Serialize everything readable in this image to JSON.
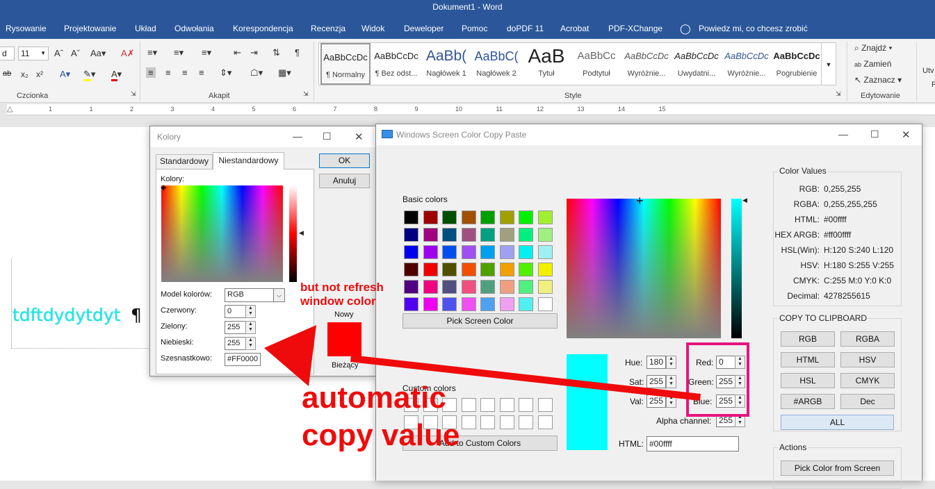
{
  "word": {
    "title": "Dokument1  -  Word",
    "tabs": [
      "Rysowanie",
      "Projektowanie",
      "Układ",
      "Odwołania",
      "Korespondencja",
      "Recenzja",
      "Widok",
      "Deweloper",
      "Pomoc",
      "doPDF 11",
      "Acrobat",
      "PDF-XChange"
    ],
    "tell_me": "Powiedz mi, co chcesz zrobić",
    "font_name_fragment": "d",
    "font_size": "11",
    "group_font": "Czcionka",
    "group_paragraph": "Akapit",
    "group_styles": "Style",
    "group_editing": "Edytowanie",
    "styles": [
      {
        "preview": "AaBbCcDc",
        "name": "¶ Normalny"
      },
      {
        "preview": "AaBbCcDc",
        "name": "¶ Bez odst..."
      },
      {
        "preview": "AaBb(",
        "name": "Nagłówek 1"
      },
      {
        "preview": "AaBbC(",
        "name": "Nagłówek 2"
      },
      {
        "preview": "AaB",
        "name": "Tytuł"
      },
      {
        "preview": "AaBbCc",
        "name": "Podtytuł"
      },
      {
        "preview": "AaBbCcDc",
        "name": "Wyróżnie..."
      },
      {
        "preview": "AaBbCcDc",
        "name": "Uwydatni..."
      },
      {
        "preview": "AaBbCcDc",
        "name": "Wyróżnie..."
      },
      {
        "preview": "AaBbCcDc",
        "name": "Pogrubienie"
      }
    ],
    "editing": {
      "find": "Znajdź",
      "replace": "Zamień",
      "select": "Zaznacz"
    },
    "right_edge_fragment": "Utv",
    "right_edge_fragment2": "P",
    "ruler_numbers": [
      "1",
      "1",
      "2",
      "3",
      "4",
      "5",
      "6",
      "7",
      "8",
      "9",
      "10",
      "11",
      "12",
      "13",
      "14",
      "15"
    ],
    "doc_text": "tdftdydytdyt",
    "pilcrow": "¶"
  },
  "kolory": {
    "title": "Kolory",
    "tab_standard": "Standardowy",
    "tab_custom": "Niestandardowy",
    "colors_label": "Kolory:",
    "ok": "OK",
    "cancel": "Anuluj",
    "model_label": "Model kolorów:",
    "model_value": "RGB",
    "red_label": "Czerwony:",
    "red_value": "0",
    "green_label": "Zielony:",
    "green_value": "255",
    "blue_label": "Niebieski:",
    "blue_value": "255",
    "hex_label": "Szesnastkowo:",
    "hex_value": "#FF0000",
    "new_label": "Nowy",
    "current_label": "Bieżący",
    "new_color": "#ff0000"
  },
  "wsccp": {
    "title": "Windows Screen Color Copy Paste",
    "basic_colors_label": "Basic colors",
    "basic_colors": [
      "#000000",
      "#a00000",
      "#005000",
      "#a05000",
      "#00a000",
      "#a0a000",
      "#00f000",
      "#a0f030",
      "#000080",
      "#a00080",
      "#005080",
      "#a05080",
      "#00a080",
      "#a0a080",
      "#00f080",
      "#a0f080",
      "#0000f0",
      "#a000f0",
      "#0050f0",
      "#a050f0",
      "#00a0f0",
      "#a0a0f0",
      "#00f0f0",
      "#a0f0f0",
      "#500000",
      "#f00000",
      "#505000",
      "#f05000",
      "#50a000",
      "#f0a000",
      "#50f000",
      "#f0f000",
      "#500080",
      "#f00080",
      "#505080",
      "#f05080",
      "#50a080",
      "#f0a080",
      "#50f080",
      "#f0f080",
      "#5000f0",
      "#f000f0",
      "#5050f0",
      "#f050f0",
      "#50a0f0",
      "#f0a0f0",
      "#50f0f0",
      "#ffffff"
    ],
    "pick_screen": "Pick Screen Color",
    "custom_colors_label": "Custom colors",
    "add_custom": "Add to Custom Colors",
    "preview_color": "#00ffff",
    "hue_label": "Hue:",
    "hue_value": "180",
    "sat_label": "Sat:",
    "sat_value": "255",
    "val_label": "Val:",
    "val_value": "255",
    "red_label": "Red:",
    "red_value": "0",
    "green_label": "Green:",
    "green_value": "255",
    "blue_label": "Blue:",
    "blue_value": "255",
    "alpha_label": "Alpha channel:",
    "alpha_value": "255",
    "html_label": "HTML:",
    "html_value": "#00ffff",
    "color_values_title": "Color Values",
    "color_values": [
      {
        "k": "RGB:",
        "v": "0,255,255"
      },
      {
        "k": "RGBA:",
        "v": "0,255,255,255"
      },
      {
        "k": "HTML:",
        "v": "#00ffff"
      },
      {
        "k": "HEX ARGB:",
        "v": "#ff00ffff"
      },
      {
        "k": "HSL(Win):",
        "v": "H:120 S:240 L:120"
      },
      {
        "k": "HSV:",
        "v": "H:180 S:255 V:255"
      },
      {
        "k": "CMYK:",
        "v": "C:255 M:0 Y:0 K:0"
      },
      {
        "k": "Decimal:",
        "v": "4278255615"
      }
    ],
    "clipboard_title": "COPY TO CLIPBOARD",
    "clipboard_buttons": [
      "RGB",
      "RGBA",
      "HTML",
      "HSV",
      "HSL",
      "CMYK",
      "#ARGB",
      "Dec"
    ],
    "clipboard_all": "ALL",
    "actions_title": "Actions",
    "pick_from_screen": "Pick Color from Screen"
  },
  "annotations": {
    "note": "but not refresh\nwindow color",
    "big_line1": "automatic",
    "big_line2": "copy value",
    "accent_red": "#ef0b0b",
    "highlight_magenta": "#e5157f"
  }
}
